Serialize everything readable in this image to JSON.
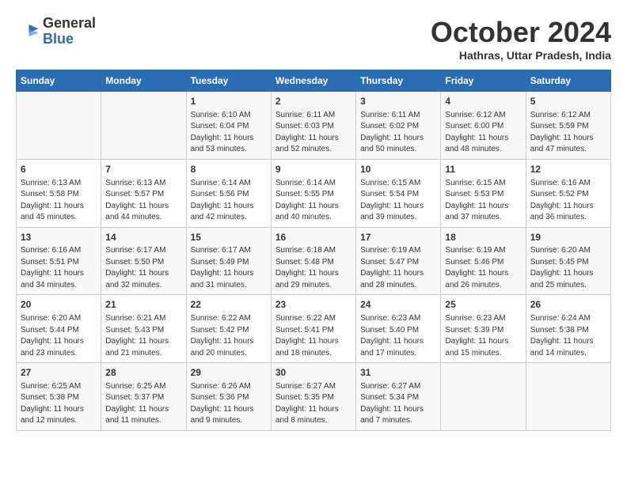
{
  "logo": {
    "general": "General",
    "blue": "Blue"
  },
  "title": "October 2024",
  "location": "Hathras, Uttar Pradesh, India",
  "days": [
    "Sunday",
    "Monday",
    "Tuesday",
    "Wednesday",
    "Thursday",
    "Friday",
    "Saturday"
  ],
  "weeks": [
    [
      {
        "day": "",
        "sunrise": "",
        "sunset": "",
        "daylight": ""
      },
      {
        "day": "",
        "sunrise": "",
        "sunset": "",
        "daylight": ""
      },
      {
        "day": "1",
        "sunrise": "Sunrise: 6:10 AM",
        "sunset": "Sunset: 6:04 PM",
        "daylight": "Daylight: 11 hours and 53 minutes."
      },
      {
        "day": "2",
        "sunrise": "Sunrise: 6:11 AM",
        "sunset": "Sunset: 6:03 PM",
        "daylight": "Daylight: 11 hours and 52 minutes."
      },
      {
        "day": "3",
        "sunrise": "Sunrise: 6:11 AM",
        "sunset": "Sunset: 6:02 PM",
        "daylight": "Daylight: 11 hours and 50 minutes."
      },
      {
        "day": "4",
        "sunrise": "Sunrise: 6:12 AM",
        "sunset": "Sunset: 6:00 PM",
        "daylight": "Daylight: 11 hours and 48 minutes."
      },
      {
        "day": "5",
        "sunrise": "Sunrise: 6:12 AM",
        "sunset": "Sunset: 5:59 PM",
        "daylight": "Daylight: 11 hours and 47 minutes."
      }
    ],
    [
      {
        "day": "6",
        "sunrise": "Sunrise: 6:13 AM",
        "sunset": "Sunset: 5:58 PM",
        "daylight": "Daylight: 11 hours and 45 minutes."
      },
      {
        "day": "7",
        "sunrise": "Sunrise: 6:13 AM",
        "sunset": "Sunset: 5:57 PM",
        "daylight": "Daylight: 11 hours and 44 minutes."
      },
      {
        "day": "8",
        "sunrise": "Sunrise: 6:14 AM",
        "sunset": "Sunset: 5:56 PM",
        "daylight": "Daylight: 11 hours and 42 minutes."
      },
      {
        "day": "9",
        "sunrise": "Sunrise: 6:14 AM",
        "sunset": "Sunset: 5:55 PM",
        "daylight": "Daylight: 11 hours and 40 minutes."
      },
      {
        "day": "10",
        "sunrise": "Sunrise: 6:15 AM",
        "sunset": "Sunset: 5:54 PM",
        "daylight": "Daylight: 11 hours and 39 minutes."
      },
      {
        "day": "11",
        "sunrise": "Sunrise: 6:15 AM",
        "sunset": "Sunset: 5:53 PM",
        "daylight": "Daylight: 11 hours and 37 minutes."
      },
      {
        "day": "12",
        "sunrise": "Sunrise: 6:16 AM",
        "sunset": "Sunset: 5:52 PM",
        "daylight": "Daylight: 11 hours and 36 minutes."
      }
    ],
    [
      {
        "day": "13",
        "sunrise": "Sunrise: 6:16 AM",
        "sunset": "Sunset: 5:51 PM",
        "daylight": "Daylight: 11 hours and 34 minutes."
      },
      {
        "day": "14",
        "sunrise": "Sunrise: 6:17 AM",
        "sunset": "Sunset: 5:50 PM",
        "daylight": "Daylight: 11 hours and 32 minutes."
      },
      {
        "day": "15",
        "sunrise": "Sunrise: 6:17 AM",
        "sunset": "Sunset: 5:49 PM",
        "daylight": "Daylight: 11 hours and 31 minutes."
      },
      {
        "day": "16",
        "sunrise": "Sunrise: 6:18 AM",
        "sunset": "Sunset: 5:48 PM",
        "daylight": "Daylight: 11 hours and 29 minutes."
      },
      {
        "day": "17",
        "sunrise": "Sunrise: 6:19 AM",
        "sunset": "Sunset: 5:47 PM",
        "daylight": "Daylight: 11 hours and 28 minutes."
      },
      {
        "day": "18",
        "sunrise": "Sunrise: 6:19 AM",
        "sunset": "Sunset: 5:46 PM",
        "daylight": "Daylight: 11 hours and 26 minutes."
      },
      {
        "day": "19",
        "sunrise": "Sunrise: 6:20 AM",
        "sunset": "Sunset: 5:45 PM",
        "daylight": "Daylight: 11 hours and 25 minutes."
      }
    ],
    [
      {
        "day": "20",
        "sunrise": "Sunrise: 6:20 AM",
        "sunset": "Sunset: 5:44 PM",
        "daylight": "Daylight: 11 hours and 23 minutes."
      },
      {
        "day": "21",
        "sunrise": "Sunrise: 6:21 AM",
        "sunset": "Sunset: 5:43 PM",
        "daylight": "Daylight: 11 hours and 21 minutes."
      },
      {
        "day": "22",
        "sunrise": "Sunrise: 6:22 AM",
        "sunset": "Sunset: 5:42 PM",
        "daylight": "Daylight: 11 hours and 20 minutes."
      },
      {
        "day": "23",
        "sunrise": "Sunrise: 6:22 AM",
        "sunset": "Sunset: 5:41 PM",
        "daylight": "Daylight: 11 hours and 18 minutes."
      },
      {
        "day": "24",
        "sunrise": "Sunrise: 6:23 AM",
        "sunset": "Sunset: 5:40 PM",
        "daylight": "Daylight: 11 hours and 17 minutes."
      },
      {
        "day": "25",
        "sunrise": "Sunrise: 6:23 AM",
        "sunset": "Sunset: 5:39 PM",
        "daylight": "Daylight: 11 hours and 15 minutes."
      },
      {
        "day": "26",
        "sunrise": "Sunrise: 6:24 AM",
        "sunset": "Sunset: 5:38 PM",
        "daylight": "Daylight: 11 hours and 14 minutes."
      }
    ],
    [
      {
        "day": "27",
        "sunrise": "Sunrise: 6:25 AM",
        "sunset": "Sunset: 5:38 PM",
        "daylight": "Daylight: 11 hours and 12 minutes."
      },
      {
        "day": "28",
        "sunrise": "Sunrise: 6:25 AM",
        "sunset": "Sunset: 5:37 PM",
        "daylight": "Daylight: 11 hours and 11 minutes."
      },
      {
        "day": "29",
        "sunrise": "Sunrise: 6:26 AM",
        "sunset": "Sunset: 5:36 PM",
        "daylight": "Daylight: 11 hours and 9 minutes."
      },
      {
        "day": "30",
        "sunrise": "Sunrise: 6:27 AM",
        "sunset": "Sunset: 5:35 PM",
        "daylight": "Daylight: 11 hours and 8 minutes."
      },
      {
        "day": "31",
        "sunrise": "Sunrise: 6:27 AM",
        "sunset": "Sunset: 5:34 PM",
        "daylight": "Daylight: 11 hours and 7 minutes."
      },
      {
        "day": "",
        "sunrise": "",
        "sunset": "",
        "daylight": ""
      },
      {
        "day": "",
        "sunrise": "",
        "sunset": "",
        "daylight": ""
      }
    ]
  ]
}
